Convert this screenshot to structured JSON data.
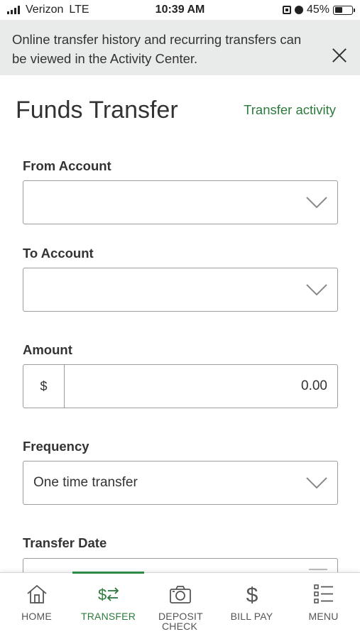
{
  "status_bar": {
    "carrier": "Verizon",
    "network": "LTE",
    "time": "10:39 AM",
    "battery": "45%",
    "battery_level": 0.45
  },
  "banner": {
    "message": "Online transfer history and recurring transfers can be viewed in the Activity Center."
  },
  "header": {
    "title": "Funds Transfer",
    "activity_link": "Transfer activity"
  },
  "form": {
    "from_account": {
      "label": "From Account",
      "value": ""
    },
    "to_account": {
      "label": "To Account",
      "value": ""
    },
    "amount": {
      "label": "Amount",
      "currency_symbol": "$",
      "value": "0.00"
    },
    "frequency": {
      "label": "Frequency",
      "value": "One time transfer"
    },
    "transfer_date": {
      "label": "Transfer Date"
    }
  },
  "bottom_nav": {
    "active_tab": "TRANSFER",
    "items": [
      {
        "label": "HOME",
        "icon": "home-icon"
      },
      {
        "label": "TRANSFER",
        "icon": "transfer-icon"
      },
      {
        "label": "DEPOSIT CHECK",
        "icon": "camera-icon"
      },
      {
        "label": "BILL PAY",
        "icon": "dollar-icon"
      },
      {
        "label": "MENU",
        "icon": "menu-list-icon"
      }
    ]
  },
  "colors": {
    "accent_green": "#2d7a3e",
    "banner_bg": "#e9eaea",
    "border_gray": "#9c9c9c"
  }
}
